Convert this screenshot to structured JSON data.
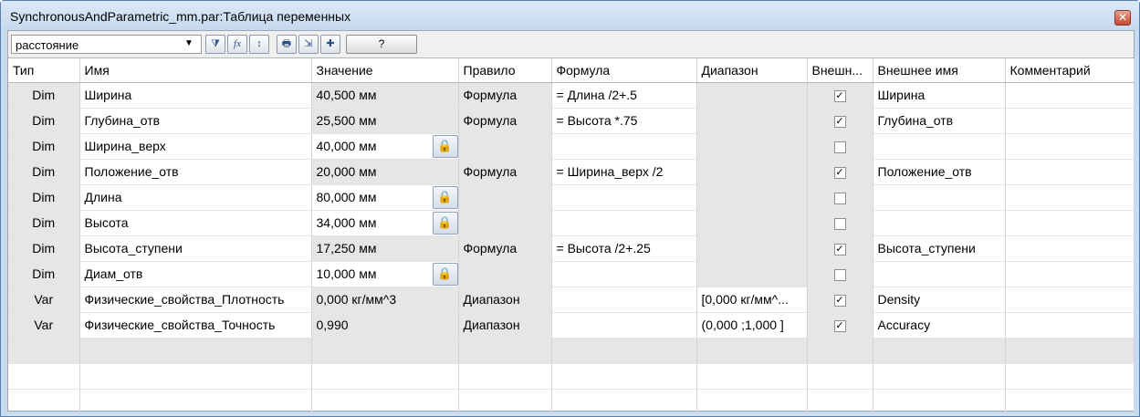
{
  "window": {
    "title": "SynchronousAndParametric_mm.par:Таблица переменных",
    "close_glyph": "✕"
  },
  "toolbar": {
    "filter_value": "расстояние",
    "dropdown_glyph": "▼",
    "buttons": [
      {
        "name": "filter-icon",
        "glyph": "⧩"
      },
      {
        "name": "formula-icon",
        "glyph": "fx"
      },
      {
        "name": "sort-icon",
        "glyph": "↕"
      },
      {
        "name": "print-icon",
        "glyph": "🖶"
      },
      {
        "name": "export-icon",
        "glyph": "⇲"
      },
      {
        "name": "add-icon",
        "glyph": "✚"
      }
    ],
    "help_label": "?"
  },
  "grid": {
    "columns": [
      "Тип",
      "Имя",
      "Значение",
      "Правило",
      "Формула",
      "Диапазон",
      "Внешн...",
      "Внешнее имя",
      "Комментарий"
    ],
    "check_glyph": "✓",
    "lock_glyph": "🔒",
    "rows": [
      {
        "type": "Dim",
        "name": "Ширина",
        "value": "40,500 мм",
        "rule": "Формула",
        "formula": "= Длина /2+.5",
        "range": "",
        "external": true,
        "external_name": "Ширина",
        "comment": "",
        "locked": false
      },
      {
        "type": "Dim",
        "name": "Глубина_отв",
        "value": "25,500 мм",
        "rule": "Формула",
        "formula": "= Высота *.75",
        "range": "",
        "external": true,
        "external_name": "Глубина_отв",
        "comment": "",
        "locked": false
      },
      {
        "type": "Dim",
        "name": "Ширина_верх",
        "value": "40,000 мм",
        "rule": "",
        "formula": "",
        "range": "",
        "external": false,
        "external_name": "",
        "comment": "",
        "locked": true
      },
      {
        "type": "Dim",
        "name": "Положение_отв",
        "value": "20,000 мм",
        "rule": "Формула",
        "formula": "= Ширина_верх /2",
        "range": "",
        "external": true,
        "external_name": "Положение_отв",
        "comment": "",
        "locked": false
      },
      {
        "type": "Dim",
        "name": "Длина",
        "value": "80,000 мм",
        "rule": "",
        "formula": "",
        "range": "",
        "external": false,
        "external_name": "",
        "comment": "",
        "locked": true
      },
      {
        "type": "Dim",
        "name": "Высота",
        "value": "34,000 мм",
        "rule": "",
        "formula": "",
        "range": "",
        "external": false,
        "external_name": "",
        "comment": "",
        "locked": true
      },
      {
        "type": "Dim",
        "name": "Высота_ступени",
        "value": "17,250 мм",
        "rule": "Формула",
        "formula": "= Высота /2+.25",
        "range": "",
        "external": true,
        "external_name": "Высота_ступени",
        "comment": "",
        "locked": false
      },
      {
        "type": "Dim",
        "name": "Диам_отв",
        "value": "10,000 мм",
        "rule": "",
        "formula": "",
        "range": "",
        "external": false,
        "external_name": "",
        "comment": "",
        "locked": true
      },
      {
        "type": "Var",
        "name": "Физические_свойства_Плотность",
        "value": "0,000 кг/мм^3",
        "rule": "Диапазон",
        "formula": "",
        "range": "[0,000 кг/мм^...",
        "external": true,
        "external_name": "Density",
        "comment": "",
        "locked": false
      },
      {
        "type": "Var",
        "name": "Физические_свойства_Точность",
        "value": "0,990",
        "rule": "Диапазон",
        "formula": "",
        "range": "(0,000  ;1,000  ]",
        "external": true,
        "external_name": "Accuracy",
        "comment": "",
        "locked": false
      }
    ]
  }
}
